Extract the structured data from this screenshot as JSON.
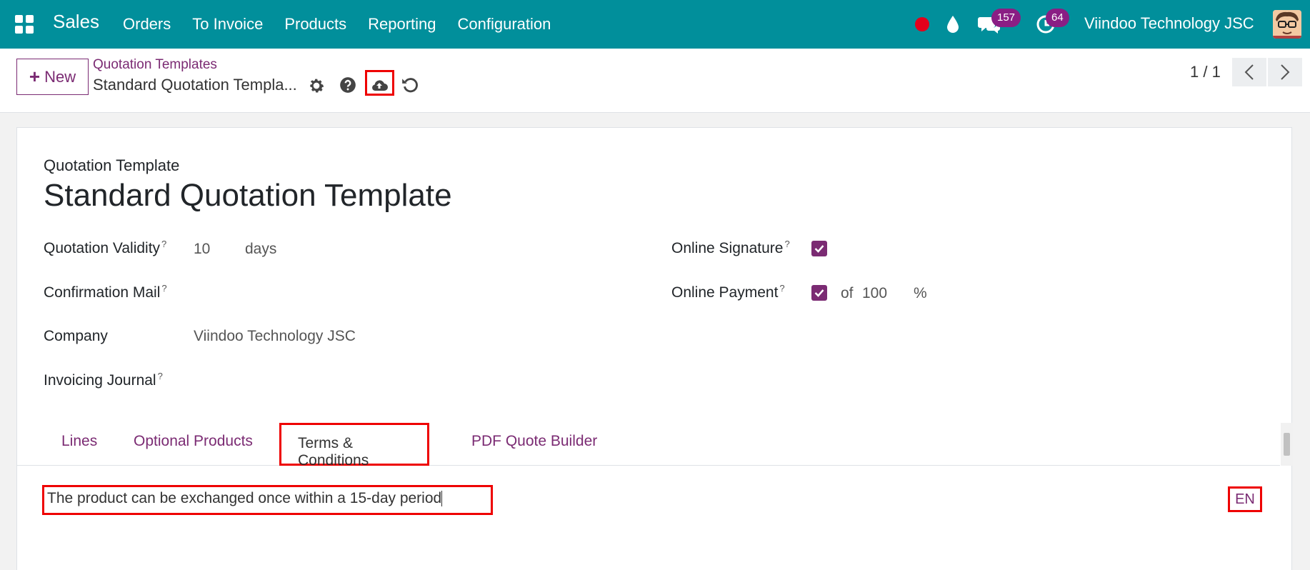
{
  "navbar": {
    "brand": "Sales",
    "menu": [
      "Orders",
      "To Invoice",
      "Products",
      "Reporting",
      "Configuration"
    ],
    "chat_count": "157",
    "activity_count": "64",
    "company": "Viindoo Technology JSC"
  },
  "control_panel": {
    "new_label": "New",
    "breadcrumb_parent": "Quotation Templates",
    "breadcrumb_current": "Standard Quotation Templa...",
    "pager": "1 / 1"
  },
  "form": {
    "small_label": "Quotation Template",
    "title": "Standard Quotation Template",
    "fields": {
      "validity_label": "Quotation Validity",
      "validity_value": "10",
      "validity_unit": "days",
      "confirmation_mail_label": "Confirmation Mail",
      "company_label": "Company",
      "company_value": "Viindoo Technology JSC",
      "journal_label": "Invoicing Journal",
      "signature_label": "Online Signature",
      "signature_checked": true,
      "payment_label": "Online Payment",
      "payment_checked": true,
      "payment_of": "of",
      "payment_value": "100",
      "payment_unit": "%",
      "help_mark": "?"
    }
  },
  "tabs": [
    {
      "label": "Lines",
      "active": false
    },
    {
      "label": "Optional Products",
      "active": false
    },
    {
      "label": "Terms & Conditions",
      "active": true
    },
    {
      "label": "PDF Quote Builder",
      "active": false
    }
  ],
  "terms": {
    "text": "The product can be exchanged once within a 15-day period",
    "lang": "EN"
  },
  "colors": {
    "navbar": "#018f9b",
    "accent": "#7b2b73",
    "badge": "#8a1e84",
    "highlight": "#e00000",
    "record_dot": "#e3001b"
  }
}
